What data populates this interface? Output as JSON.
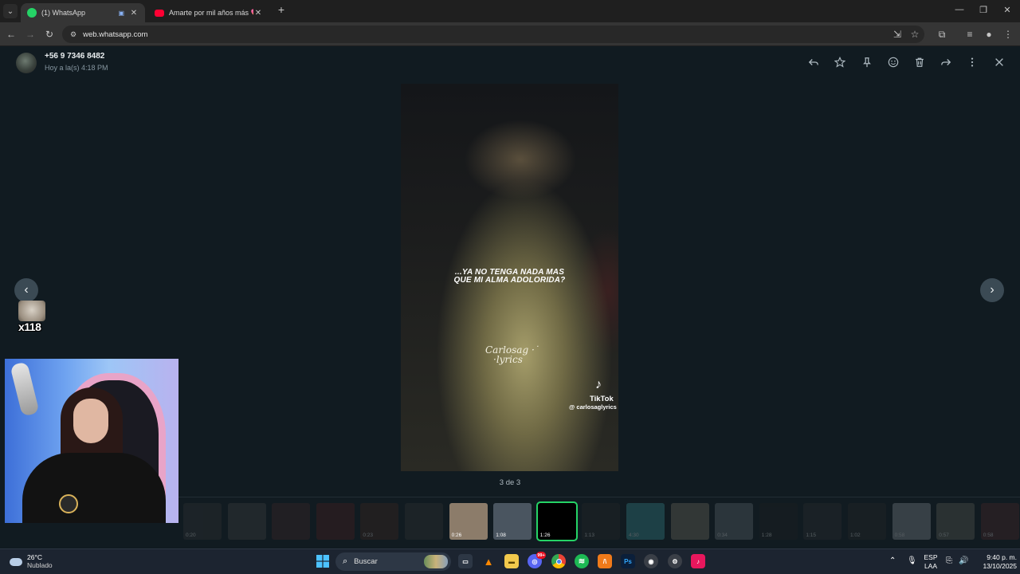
{
  "browser": {
    "tabs": [
      {
        "title": "(1) WhatsApp",
        "favicon_color": "#25d366",
        "active": true
      },
      {
        "title": "Amarte por mil años más 💖 [e",
        "favicon_color": "#ff0033",
        "active": false
      }
    ],
    "new_tab": "+",
    "url": "web.whatsapp.com"
  },
  "viewer": {
    "sender_name": "+56 9 7346 8482",
    "sender_time": "Hoy a la(s) 4:18 PM",
    "actions": [
      "reply-icon",
      "star-icon",
      "pin-icon",
      "emoji-icon",
      "delete-icon",
      "forward-icon",
      "more-icon",
      "close-icon"
    ],
    "video": {
      "lyric_line1": "...YA NO TENGA NADA MAS",
      "lyric_line2": "QUE MI ALMA ADOLORIDA?",
      "watermark_line1": "Carlosag ·˙",
      "watermark_line2": "·lyrics",
      "tiktok_name": "TikTok",
      "tiktok_handle": "@ carlosaglyrics"
    },
    "counter": "3 de 3",
    "thumbnails": [
      {
        "duration": "0:20",
        "color": "#3a3a3a",
        "state": "dim"
      },
      {
        "duration": "",
        "color": "#4a4a4a",
        "state": "dim"
      },
      {
        "duration": "",
        "color": "#4a2a2a",
        "state": "dim"
      },
      {
        "duration": "",
        "color": "#5a1f1f",
        "state": "dim"
      },
      {
        "duration": "0:23",
        "color": "#4a2a20",
        "state": "dim"
      },
      {
        "duration": "",
        "color": "#3a3a3a",
        "state": "dim"
      },
      {
        "duration": "0:26",
        "color": "#8c7c6a",
        "state": "visible"
      },
      {
        "duration": "1:08",
        "color": "#4a5560",
        "state": "visible"
      },
      {
        "duration": "1:26",
        "color": "#000000",
        "state": "selected"
      },
      {
        "duration": "1:13",
        "color": "#2a2a2a",
        "state": "dim"
      },
      {
        "duration": "4:30",
        "color": "#3fa0a8",
        "state": "dim"
      },
      {
        "duration": "",
        "color": "#8a8070",
        "state": "dim"
      },
      {
        "duration": "0:34",
        "color": "#707a80",
        "state": "dim"
      },
      {
        "duration": "1:28",
        "color": "#222",
        "state": "dim"
      },
      {
        "duration": "1:15",
        "color": "#333",
        "state": "dim"
      },
      {
        "duration": "1:02",
        "color": "#2a2a2a",
        "state": "dim"
      },
      {
        "duration": "0:58",
        "color": "#9aa0a8",
        "state": "dim"
      },
      {
        "duration": "0:57",
        "color": "#6a6a60",
        "state": "dim"
      },
      {
        "duration": "0:58",
        "color": "#5a2a2a",
        "state": "dim"
      },
      {
        "duration": "1:02",
        "color": "#8898b0",
        "state": "dim"
      }
    ]
  },
  "overlay": {
    "sticker_count": "x118"
  },
  "taskbar": {
    "weather_temp": "26°C",
    "weather_desc": "Nublado",
    "search_label": "Buscar",
    "badge_count": "99+",
    "lang_line1": "ESP",
    "lang_line2": "LAA",
    "time": "9:40 p. m.",
    "date": "13/10/2025"
  }
}
